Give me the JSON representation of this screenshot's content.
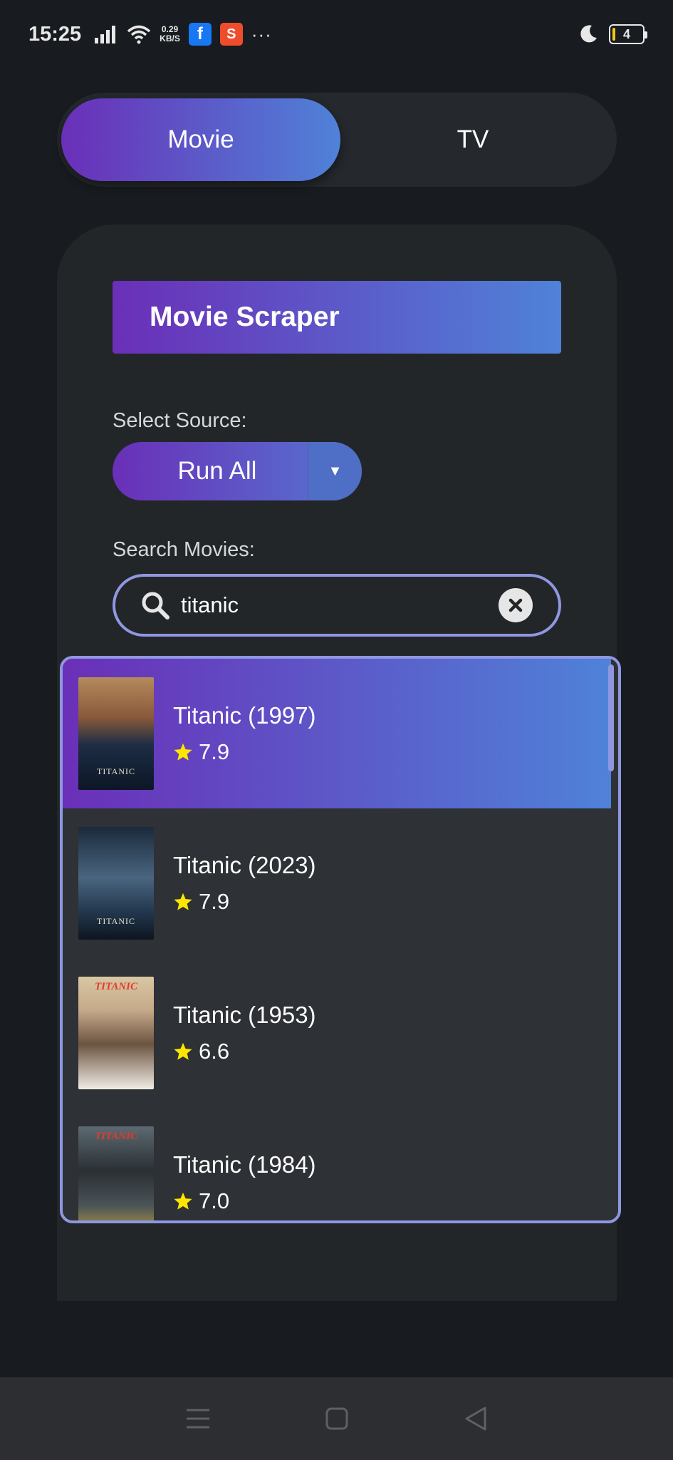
{
  "status_bar": {
    "time": "15:25",
    "net_speed_value": "0.29",
    "net_speed_unit": "KB/S",
    "fb_icon_letter": "f",
    "shop_icon_letter": "S",
    "more": "···",
    "battery_level": "4"
  },
  "tabs": {
    "movie_label": "Movie",
    "tv_label": "TV"
  },
  "header": {
    "title": "Movie Scraper"
  },
  "source": {
    "label": "Select Source:",
    "selected": "Run All",
    "arrow": "▼"
  },
  "search": {
    "label": "Search Movies:",
    "value": "titanic"
  },
  "results": [
    {
      "title": "Titanic (1997)",
      "rating": "7.9",
      "poster_text": "TITANIC"
    },
    {
      "title": "Titanic (2023)",
      "rating": "7.9",
      "poster_text": "TITANIC"
    },
    {
      "title": "Titanic (1953)",
      "rating": "6.6",
      "poster_text": "TITANIC"
    },
    {
      "title": "Titanic (1984)",
      "rating": "7.0",
      "poster_text": "TITANIC"
    }
  ],
  "colors": {
    "accent_start": "#6a2fb8",
    "accent_end": "#4f82d8",
    "border": "#8f97e0",
    "star": "#ffe600"
  }
}
